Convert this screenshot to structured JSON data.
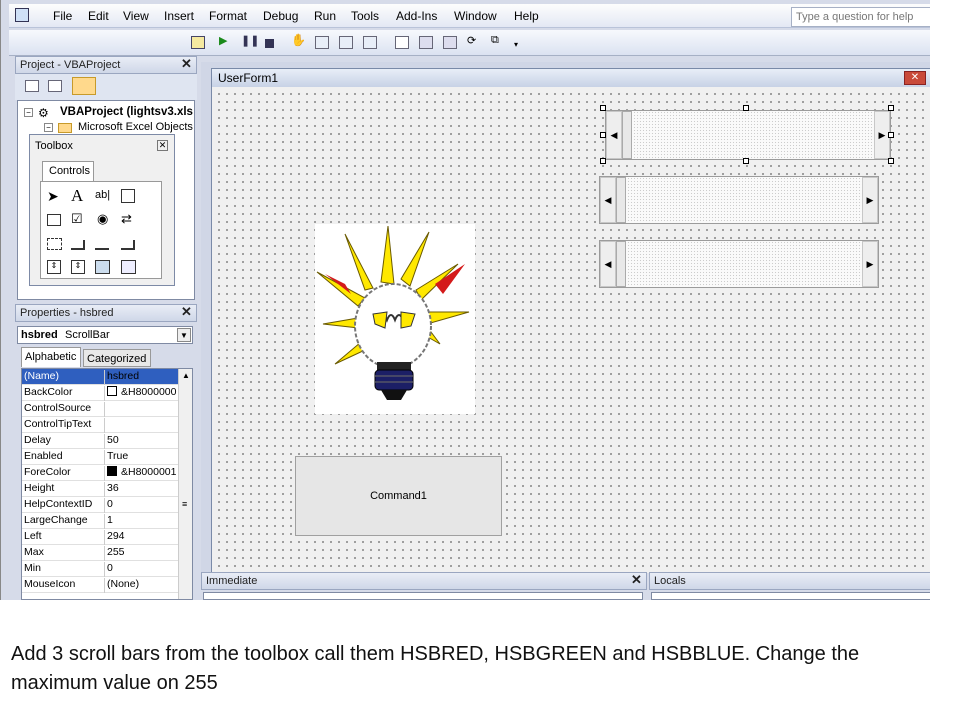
{
  "menubar": {
    "items": [
      "File",
      "Edit",
      "View",
      "Insert",
      "Format",
      "Debug",
      "Run",
      "Tools",
      "Add-Ins",
      "Window",
      "Help"
    ],
    "ask_placeholder": "Type a question for help"
  },
  "project": {
    "title": "Project - VBAProject",
    "tree": [
      "VBAProject (lightsv3.xls",
      "Microsoft Excel Objects"
    ]
  },
  "toolbox": {
    "title": "Toolbox",
    "tab": "Controls"
  },
  "properties": {
    "title": "Properties - hsbred",
    "object_name": "hsbred",
    "object_type": "ScrollBar",
    "tabs": [
      "Alphabetic",
      "Categorized"
    ],
    "rows": [
      {
        "name": "(Name)",
        "value": "hsbred"
      },
      {
        "name": "BackColor",
        "value": "&H8000000"
      },
      {
        "name": "ControlSource",
        "value": ""
      },
      {
        "name": "ControlTipText",
        "value": ""
      },
      {
        "name": "Delay",
        "value": "50"
      },
      {
        "name": "Enabled",
        "value": "True"
      },
      {
        "name": "ForeColor",
        "value": "&H8000001"
      },
      {
        "name": "Height",
        "value": "36"
      },
      {
        "name": "HelpContextID",
        "value": "0"
      },
      {
        "name": "LargeChange",
        "value": "1"
      },
      {
        "name": "Left",
        "value": "294"
      },
      {
        "name": "Max",
        "value": "255"
      },
      {
        "name": "Min",
        "value": "0"
      },
      {
        "name": "MouseIcon",
        "value": "(None)"
      }
    ]
  },
  "userform": {
    "title": "UserForm1",
    "command_label": "Command1"
  },
  "immediate": {
    "title": "Immediate"
  },
  "locals": {
    "title": "Locals"
  },
  "caption": "Add 3 scroll bars from the toolbox call them HSBRED, HSBGREEN  and HSBBLUE. Change the maximum value on 255"
}
